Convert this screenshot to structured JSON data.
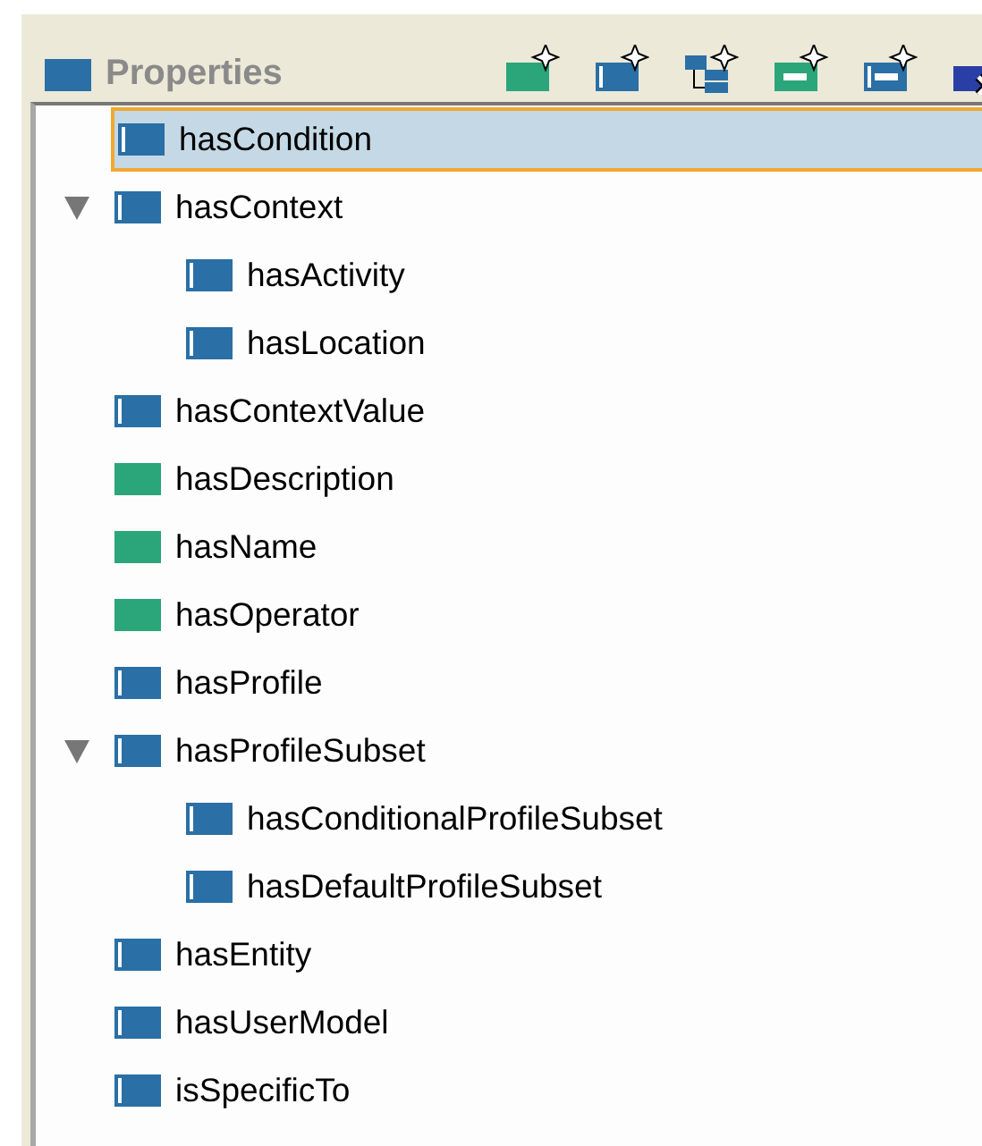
{
  "panel": {
    "title": "Properties"
  },
  "toolbar": [
    {
      "kind": "datatype"
    },
    {
      "kind": "object"
    },
    {
      "kind": "subproperty"
    },
    {
      "kind": "datatype-bar"
    },
    {
      "kind": "object-bar"
    },
    {
      "kind": "delete"
    }
  ],
  "tree": [
    {
      "label": "hasCondition",
      "kind": "object",
      "selected": true
    },
    {
      "label": "hasContext",
      "kind": "object",
      "selected": false,
      "expanded": true,
      "children": [
        {
          "label": "hasActivity",
          "kind": "object",
          "selected": false
        },
        {
          "label": "hasLocation",
          "kind": "object",
          "selected": false
        }
      ]
    },
    {
      "label": "hasContextValue",
      "kind": "object",
      "selected": false
    },
    {
      "label": "hasDescription",
      "kind": "datatype",
      "selected": false
    },
    {
      "label": "hasName",
      "kind": "datatype",
      "selected": false
    },
    {
      "label": "hasOperator",
      "kind": "datatype",
      "selected": false
    },
    {
      "label": "hasProfile",
      "kind": "object",
      "selected": false
    },
    {
      "label": "hasProfileSubset",
      "kind": "object",
      "selected": false,
      "expanded": true,
      "children": [
        {
          "label": "hasConditionalProfileSubset",
          "kind": "object",
          "selected": false
        },
        {
          "label": "hasDefaultProfileSubset",
          "kind": "object",
          "selected": false
        }
      ]
    },
    {
      "label": "hasEntity",
      "kind": "object",
      "selected": false
    },
    {
      "label": "hasUserModel",
      "kind": "object",
      "selected": false
    },
    {
      "label": "isSpecificTo",
      "kind": "object",
      "selected": false
    }
  ]
}
